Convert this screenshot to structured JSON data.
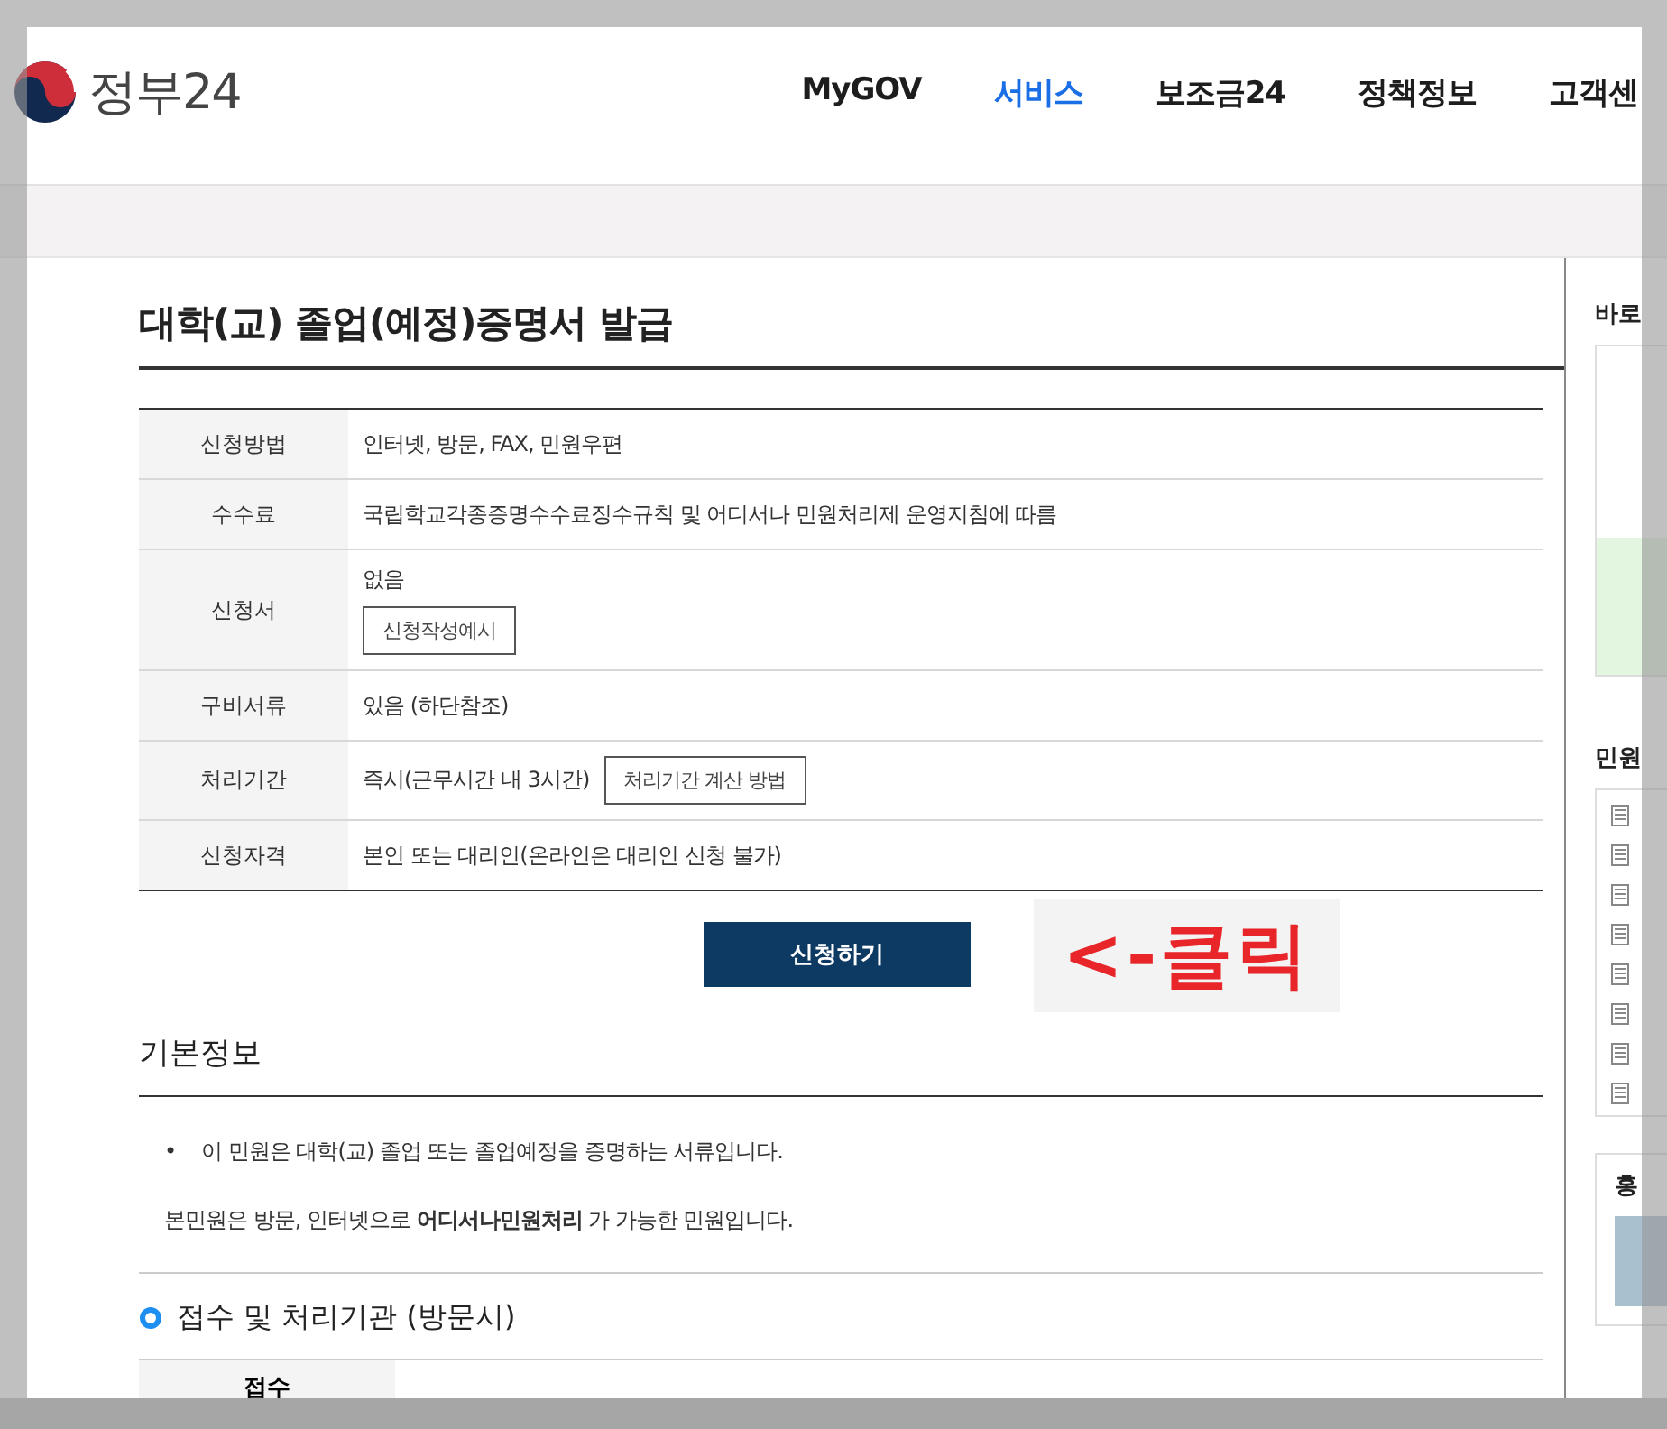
{
  "header": {
    "logo_text": "정부24",
    "nav": [
      {
        "label": "MyGOV",
        "selected": false
      },
      {
        "label": "서비스",
        "selected": true
      },
      {
        "label": "보조금24",
        "selected": false
      },
      {
        "label": "정책정보",
        "selected": false
      },
      {
        "label": "고객센",
        "selected": false
      }
    ]
  },
  "title": "대학(교) 졸업(예정)증명서 발급",
  "info_table": [
    {
      "label": "신청방법",
      "value": "인터넷, 방문, FAX, 민원우편"
    },
    {
      "label": "수수료",
      "value": "국립학교각종증명수수료징수규칙 및 어디서나 민원처리제 운영지침에 따름"
    },
    {
      "label": "신청서",
      "value": "없음",
      "button": "신청작성예시",
      "kind": "button_below"
    },
    {
      "label": "구비서류",
      "value": "있음 (하단참조)"
    },
    {
      "label": "처리기간",
      "value": "즉시(근무시간 내 3시간)",
      "button": "처리기간 계산 방법",
      "kind": "button_inline"
    },
    {
      "label": "신청자격",
      "value": "본인 또는 대리인(온라인은 대리인 신청 불가)"
    }
  ],
  "apply_button": "신청하기",
  "annotation": "<-클릭",
  "basic_info": {
    "heading": "기본정보",
    "bullet_marker": "•",
    "bullets": [
      "이 민원은 대학(교) 졸업 또는 졸업예정을 증명하는 서류입니다."
    ],
    "note": "본민원은 방문, 인터넷으로 **어디서나민원처리** 가 가능한 민원입니다."
  },
  "offices": {
    "heading": "접수 및 처리기관 (방문시)",
    "row_label": "접수"
  },
  "sidebar": {
    "headings": [
      "바로",
      "민원",
      "홍"
    ]
  }
}
